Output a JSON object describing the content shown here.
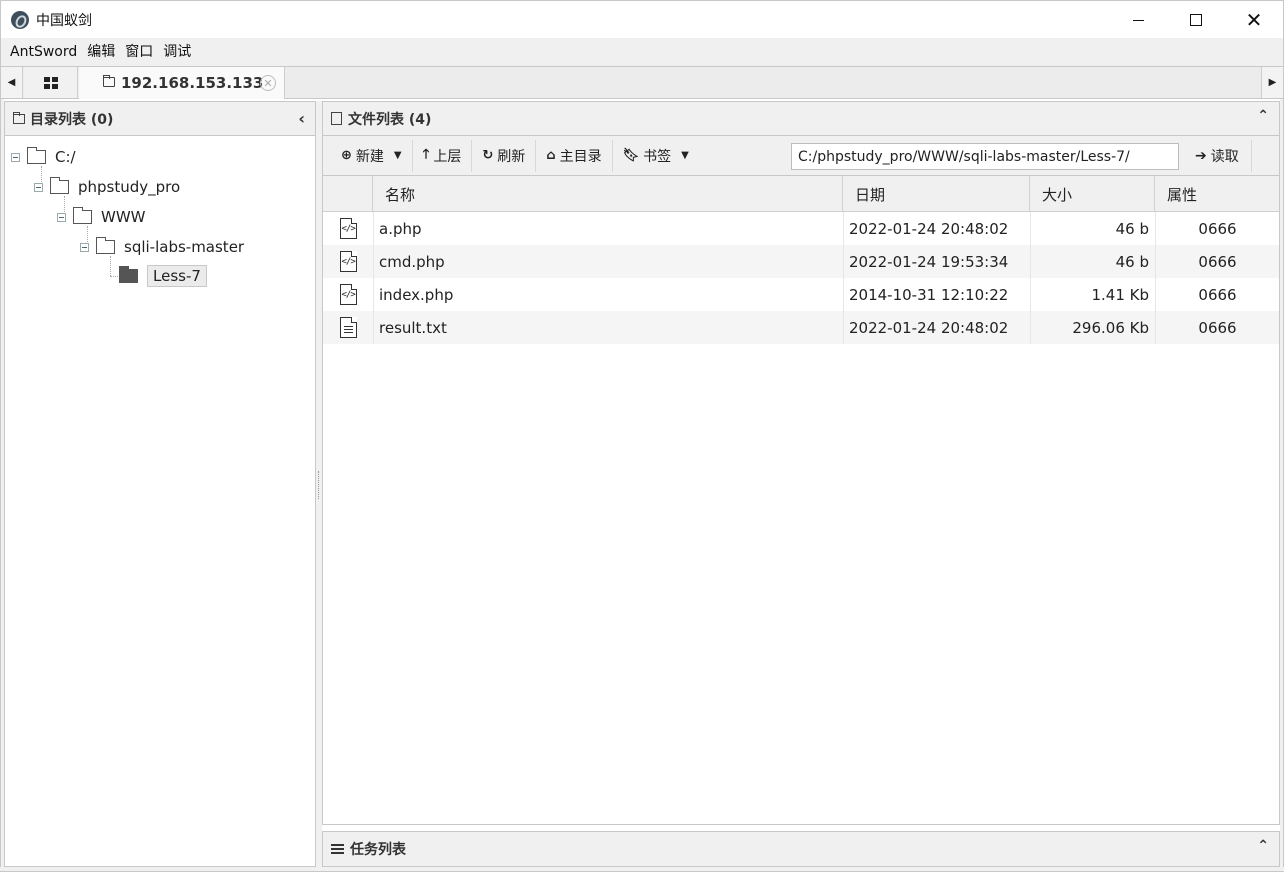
{
  "window": {
    "title": "中国蚁剑"
  },
  "menu": {
    "items": [
      "AntSword",
      "编辑",
      "窗口",
      "调试"
    ]
  },
  "tabs": {
    "host_label": "192.168.153.133"
  },
  "left_panel": {
    "header": "目录列表 (0)",
    "tree": [
      {
        "label": "C:/",
        "depth": 0
      },
      {
        "label": "phpstudy_pro",
        "depth": 1
      },
      {
        "label": "WWW",
        "depth": 2
      },
      {
        "label": "sqli-labs-master",
        "depth": 3
      },
      {
        "label": "Less-7",
        "depth": 4,
        "selected": true
      }
    ]
  },
  "right_panel": {
    "header": "文件列表 (4)",
    "toolbar": {
      "new_label": "新建",
      "up_label": "上层",
      "refresh_label": "刷新",
      "home_label": "主目录",
      "bookmark_label": "书签",
      "path_value": "C:/phpstudy_pro/WWW/sqli-labs-master/Less-7/",
      "read_label": "读取"
    },
    "columns": {
      "name": "名称",
      "date": "日期",
      "size": "大小",
      "attr": "属性"
    },
    "files": [
      {
        "icon": "code-file-icon",
        "name": "a.php",
        "date": "2022-01-24 20:48:02",
        "size": "46 b",
        "attr": "0666"
      },
      {
        "icon": "code-file-icon",
        "name": "cmd.php",
        "date": "2022-01-24 19:53:34",
        "size": "46 b",
        "attr": "0666"
      },
      {
        "icon": "code-file-icon",
        "name": "index.php",
        "date": "2014-10-31 12:10:22",
        "size": "1.41 Kb",
        "attr": "0666"
      },
      {
        "icon": "text-file-icon",
        "name": "result.txt",
        "date": "2022-01-24 20:48:02",
        "size": "296.06 Kb",
        "attr": "0666"
      }
    ]
  },
  "task_panel": {
    "header": "任务列表"
  }
}
